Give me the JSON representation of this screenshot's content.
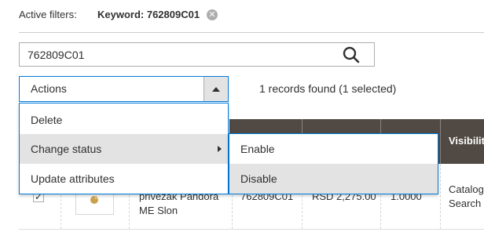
{
  "filters": {
    "label": "Active filters:",
    "keyword": "Keyword: 762809C01",
    "remove_glyph": "✕"
  },
  "search": {
    "value": "762809C01",
    "icon": "search-icon"
  },
  "actions": {
    "label": "Actions",
    "toggle_icon": "triangle-up-icon",
    "menu": [
      {
        "label": "Delete"
      },
      {
        "label": "Change status",
        "has_submenu": true
      },
      {
        "label": "Update attributes"
      }
    ],
    "submenu": [
      {
        "label": "Enable"
      },
      {
        "label": "Disable"
      }
    ]
  },
  "records": "1 records found (1 selected)",
  "grid": {
    "header_visibility": "Visibilit",
    "row": {
      "checked_glyph": "✓",
      "name_line1": "privezak Pandora",
      "name_line2": "ME Slon",
      "sku": "762809C01",
      "price": "RSD 2,275.00",
      "qty": "1.0000",
      "visibility_line1": "Catalog,",
      "visibility_line2": "Search"
    }
  },
  "colors": {
    "accent_border": "#007bdb",
    "grid_header": "#514943",
    "highlight": "#e3e3e3"
  }
}
